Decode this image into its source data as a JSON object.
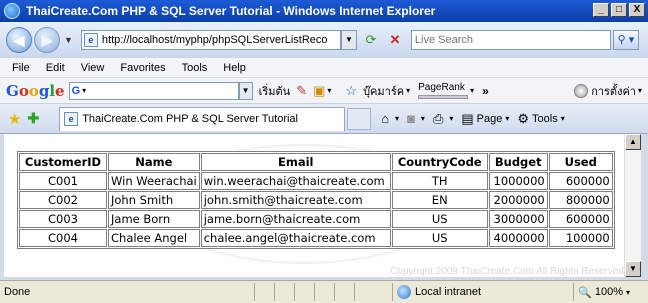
{
  "window": {
    "title": "ThaiCreate.Com PHP & SQL Server Tutorial - Windows Internet Explorer",
    "controls": [
      "_",
      "□",
      "X"
    ]
  },
  "address_bar": {
    "url": "http://localhost/myphp/phpSQLServerListReco",
    "search_placeholder": "Live Search"
  },
  "menu": {
    "items": [
      "File",
      "Edit",
      "View",
      "Favorites",
      "Tools",
      "Help"
    ]
  },
  "google_toolbar": {
    "logo": "Google",
    "search_icon_label": "G",
    "start_label": "เริ่มต้น",
    "bookmarks_label": "บุ๊คมาร์ค",
    "pagerank_label": "PageRank",
    "more_label": "»",
    "settings_label": "การตั้งค่า"
  },
  "tabs": {
    "active_tab_title": "ThaiCreate.Com PHP & SQL Server Tutorial",
    "commands": [
      {
        "icon": "home-icon",
        "label": ""
      },
      {
        "icon": "feeds-icon",
        "label": ""
      },
      {
        "icon": "print-icon",
        "label": ""
      },
      {
        "icon": "page-icon",
        "label": "Page"
      },
      {
        "icon": "tools-icon",
        "label": "Tools"
      }
    ]
  },
  "table": {
    "headers": [
      "CustomerID",
      "Name",
      "Email",
      "CountryCode",
      "Budget",
      "Used"
    ],
    "rows": [
      [
        "C001",
        "Win Weerachai",
        "win.weerachai@thaicreate.com",
        "TH",
        "1000000",
        "600000"
      ],
      [
        "C002",
        "John Smith",
        "john.smith@thaicreate.com",
        "EN",
        "2000000",
        "800000"
      ],
      [
        "C003",
        "Jame Born",
        "jame.born@thaicreate.com",
        "US",
        "3000000",
        "600000"
      ],
      [
        "C004",
        "Chalee Angel",
        "chalee.angel@thaicreate.com",
        "US",
        "4000000",
        "100000"
      ]
    ]
  },
  "watermark": {
    "copyright": "Copyright 2009 ThaiCreate.Com All Rights Reserved"
  },
  "status_bar": {
    "status": "Done",
    "zone": "Local intranet",
    "zoom": "100%"
  },
  "colors": {
    "title_bar": "#0a3fa8",
    "content_bg": "#ffffff",
    "table_border": "#808080"
  }
}
